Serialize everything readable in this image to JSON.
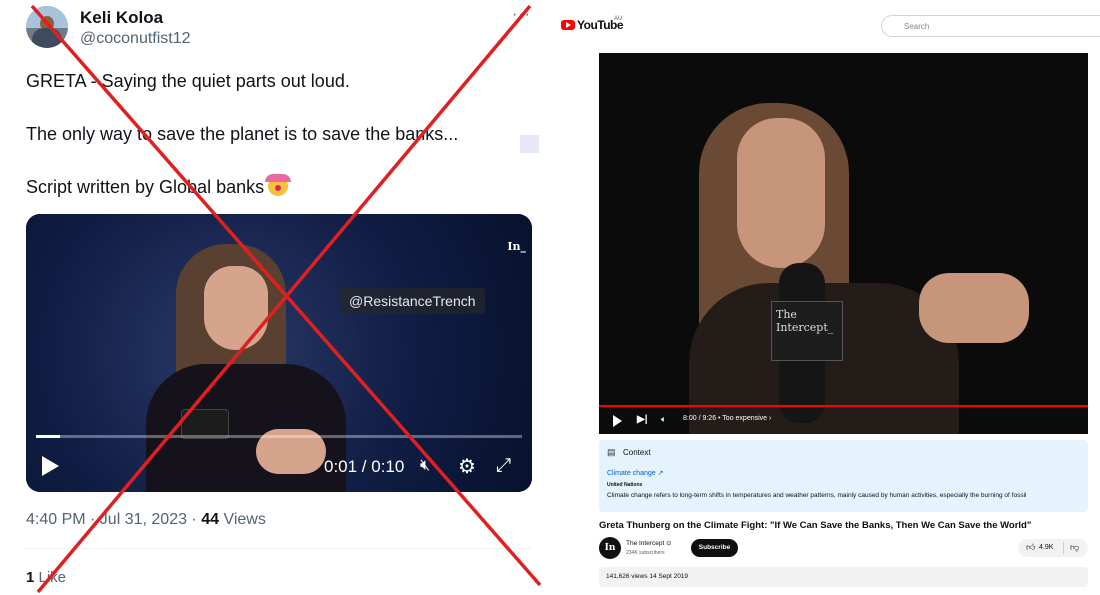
{
  "tweet": {
    "author_name": "Keli Koloa",
    "author_handle": "@coconutfist12",
    "more_label": "···",
    "text_lines": [
      "GRETA - Saying the quiet parts out loud.",
      "The only way to save the planet is to save the banks...",
      "Script written by Global banks"
    ],
    "video": {
      "channel_logo": "In_",
      "watermark": "@ResistanceTrench",
      "time_display": "0:01 / 0:10",
      "progress": 0.05
    },
    "time": "4:40 PM · Jul 31, 2023 · ",
    "views_count": "44",
    "views_label": " Views",
    "likes_count": "1",
    "likes_label": " Like"
  },
  "youtube": {
    "logo_text": "YouTube",
    "region": "AU",
    "search_placeholder": "Search",
    "player": {
      "mic_label": "The Intercept_",
      "time_display": "8:00 / 9:26 • Too expensive",
      "chapter_chevron": "›",
      "progress": 0.85
    },
    "context": {
      "title": "Context",
      "link": "Climate change",
      "source": "United Nations",
      "description": "Climate change refers to long-term shifts in temperatures and weather patterns, mainly caused by human activities, especially the burning of fossil"
    },
    "video_title": "Greta Thunberg on the Climate Fight: \"If We Can Save the Banks, Then We Can Save the World\"",
    "channel": {
      "avatar_text": "In",
      "name": "The Intercept",
      "verified": "⊙",
      "subscribers": "234K subscribers",
      "subscribe_label": "Subscribe"
    },
    "likes": "4.9K",
    "views_date": "141,626 views  14 Sept 2019"
  },
  "colors": {
    "cross": "#e02020",
    "yt_red": "#ff0000",
    "context_bg": "#e5f3fd"
  }
}
